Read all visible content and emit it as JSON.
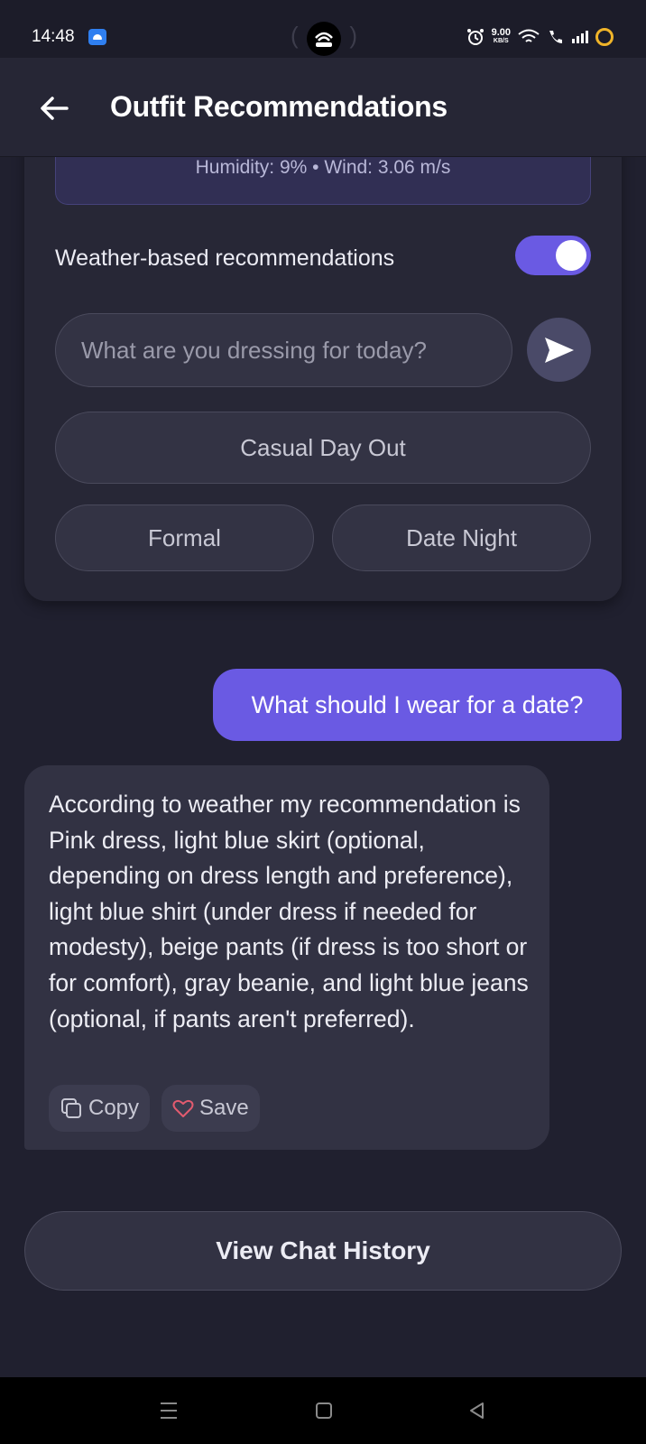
{
  "status_bar": {
    "time": "14:48",
    "net_speed_value": "9.00",
    "net_speed_unit": "KB/S",
    "icons": [
      "android-icon",
      "alarm-icon",
      "wifi-icon",
      "wifi-call-icon",
      "signal-icon",
      "battery-icon"
    ]
  },
  "app_bar": {
    "title": "Outfit Recommendations",
    "back_icon": "arrow-left-icon"
  },
  "weather": {
    "stats": "Humidity: 9% • Wind: 3.06 m/s"
  },
  "toggle": {
    "label": "Weather-based recommendations",
    "enabled": true
  },
  "search": {
    "placeholder": "What are you dressing for today?",
    "value": ""
  },
  "chips": {
    "casual": "Casual Day Out",
    "formal": "Formal",
    "date_night": "Date Night"
  },
  "messages": {
    "user": "What should I wear for a date?",
    "bot": "According to weather my recommendation is Pink dress, light blue skirt (optional, depending on dress length and preference), light blue shirt (under dress if needed for modesty), beige pants (if dress is too short or for comfort),  gray beanie, and light blue jeans (optional, if pants aren't preferred).",
    "copy_label": "Copy",
    "save_label": "Save"
  },
  "history_button": "View Chat History",
  "colors": {
    "background": "#20202f",
    "card": "#272736",
    "accent": "#6a5ae3",
    "heart": "#e25b6f"
  }
}
